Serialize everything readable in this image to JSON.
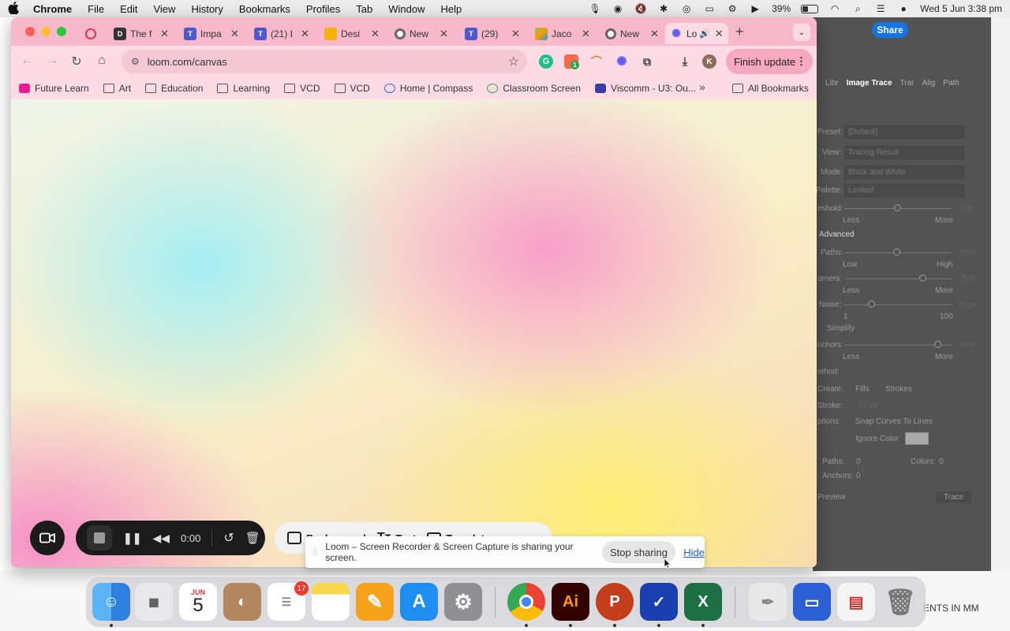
{
  "menubar": {
    "app_name": "Chrome",
    "items": [
      "File",
      "Edit",
      "View",
      "History",
      "Bookmarks",
      "Profiles",
      "Tab",
      "Window",
      "Help"
    ],
    "battery": "39%",
    "datetime": "Wed 5 Jun  3:38 pm"
  },
  "tabs": [
    {
      "title": "",
      "favicon": "record-icon",
      "color": "#e2354a"
    },
    {
      "title": "The f",
      "favicon": "d-logo-icon",
      "color": "#333333"
    },
    {
      "title": "Impa",
      "favicon": "teams-icon",
      "color": "#5059c9"
    },
    {
      "title": "(21) I",
      "favicon": "teams-icon",
      "color": "#5059c9"
    },
    {
      "title": "Desi",
      "favicon": "slides-icon",
      "color": "#f4b400"
    },
    {
      "title": "New",
      "favicon": "chrome-icon",
      "color": "#666666"
    },
    {
      "title": "(29)",
      "favicon": "teams-icon",
      "color": "#5059c9"
    },
    {
      "title": "Jaco",
      "favicon": "grid-icon",
      "color": "#8bc34a"
    },
    {
      "title": "New",
      "favicon": "chrome-icon",
      "color": "#666666"
    },
    {
      "title": "Lo",
      "favicon": "loom-icon",
      "color": "#625df5",
      "active": true
    }
  ],
  "toolbar": {
    "url": "loom.com/canvas",
    "finish_update": "Finish update",
    "profile_initial": "K",
    "ext_badge": "1"
  },
  "bookmarks": {
    "items": [
      "Future Learn",
      "Art",
      "Education",
      "Learning",
      "VCD",
      "VCD",
      "Home | Compass",
      "Classroom Screen",
      "Viscomm - U3: Ou..."
    ],
    "all": "All Bookmarks"
  },
  "loom": {
    "timer": "0:00",
    "tools": [
      "Background",
      "Text",
      "Template"
    ],
    "share_message": "Loom – Screen Recorder & Screen Capture is sharing your screen.",
    "stop_sharing": "Stop sharing",
    "hide": "Hide"
  },
  "illustrator": {
    "share": "Share",
    "tabs": [
      "Libr",
      "Image Trace",
      "Trar",
      "Alig",
      "Path"
    ],
    "preset_label": "Preset:",
    "preset_value": "[Default]",
    "view_label": "View:",
    "view_value": "Tracing Result",
    "mode_label": "Mode:",
    "mode_value": "Black and White",
    "palette_label": "Palette:",
    "palette_value": "Limited",
    "threshold_label": "eshold:",
    "threshold_value": "128",
    "less": "Less",
    "more": "More",
    "advanced": "Advanced",
    "paths_label": "Paths:",
    "paths_value": "50%",
    "low": "Low",
    "high": "High",
    "corners_label": "orners:",
    "corners_value": "75%",
    "noise_label": "Noise:",
    "noise_value": "25 px",
    "noise_min": "1",
    "noise_max": "100",
    "simplify": "Simplify",
    "anchors_label": "nchors:",
    "anchors_value": "80%",
    "method_label": "ethod:",
    "create_label": "Create:",
    "fills": "Fills",
    "strokes": "Strokes",
    "stroke_label": "Stroke:",
    "stroke_value": "10 px",
    "options_label": "ptions:",
    "snap": "Snap Curves To Lines",
    "ignore_color": "Ignore Color",
    "paths_count_label": "Paths:",
    "paths_count": "0",
    "colors_label": "Colors:",
    "colors_count": "0",
    "anchors_count_label": "Anchors:",
    "anchors_count": "0",
    "preview": "Preview",
    "trace": "Trace"
  },
  "background_doc": {
    "text": "ENTS IN MM"
  },
  "dock": {
    "calendar_month": "JUN",
    "calendar_day": "5",
    "reminders_badge": "17",
    "apps": [
      "finder",
      "launchpad",
      "calendar",
      "contacts",
      "reminders",
      "notes",
      "pages",
      "app-store",
      "system-settings",
      "chrome",
      "illustrator",
      "powerpoint",
      "vpn",
      "excel"
    ]
  }
}
